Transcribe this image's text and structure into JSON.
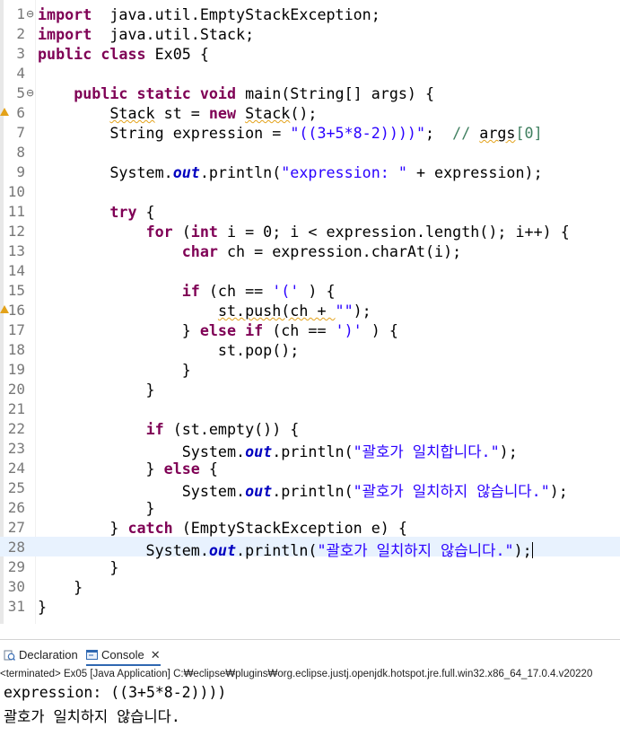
{
  "editor": {
    "lines": [
      {
        "n": "1",
        "fold": "⊖",
        "segs": [
          [
            "kw",
            "import"
          ],
          [
            "",
            "  java.util.EmptyStackException;"
          ]
        ]
      },
      {
        "n": "2",
        "segs": [
          [
            "kw",
            "import"
          ],
          [
            "",
            "  java.util.Stack;"
          ]
        ]
      },
      {
        "n": "3",
        "segs": [
          [
            "kw",
            "public"
          ],
          [
            "",
            " "
          ],
          [
            "kw",
            "class"
          ],
          [
            "",
            " Ex05 {"
          ]
        ]
      },
      {
        "n": "4",
        "segs": []
      },
      {
        "n": "5",
        "fold": "⊖",
        "segs": [
          [
            "",
            "    "
          ],
          [
            "kw",
            "public"
          ],
          [
            "",
            " "
          ],
          [
            "kw",
            "static"
          ],
          [
            "",
            " "
          ],
          [
            "kw",
            "void"
          ],
          [
            "",
            " main(String[] args) {"
          ]
        ]
      },
      {
        "n": "6",
        "warn": true,
        "segs": [
          [
            "",
            "        "
          ],
          [
            "sq",
            "Stack"
          ],
          [
            "",
            " st = "
          ],
          [
            "kw",
            "new"
          ],
          [
            "",
            " "
          ],
          [
            "sq",
            "Stack"
          ],
          [
            "",
            "();"
          ]
        ]
      },
      {
        "n": "7",
        "segs": [
          [
            "",
            "        String expression = "
          ],
          [
            "str",
            "\"((3+5*8-2))))\""
          ],
          [
            "",
            ";  "
          ],
          [
            "cmt",
            "// "
          ],
          [
            "sqc",
            "args"
          ],
          [
            "cmt",
            "[0]"
          ]
        ]
      },
      {
        "n": "8",
        "segs": []
      },
      {
        "n": "9",
        "segs": [
          [
            "",
            "        System."
          ],
          [
            "fld",
            "out"
          ],
          [
            "",
            ".println("
          ],
          [
            "str",
            "\"expression: \""
          ],
          [
            "",
            " + expression);"
          ]
        ]
      },
      {
        "n": "10",
        "segs": []
      },
      {
        "n": "11",
        "segs": [
          [
            "",
            "        "
          ],
          [
            "kw",
            "try"
          ],
          [
            "",
            " {"
          ]
        ]
      },
      {
        "n": "12",
        "segs": [
          [
            "",
            "            "
          ],
          [
            "kw",
            "for"
          ],
          [
            "",
            " ("
          ],
          [
            "kw",
            "int"
          ],
          [
            "",
            " i = 0; i < expression.length(); i++) {"
          ]
        ]
      },
      {
        "n": "13",
        "segs": [
          [
            "",
            "                "
          ],
          [
            "kw",
            "char"
          ],
          [
            "",
            " ch = expression.charAt(i);"
          ]
        ]
      },
      {
        "n": "14",
        "segs": []
      },
      {
        "n": "15",
        "segs": [
          [
            "",
            "                "
          ],
          [
            "kw",
            "if"
          ],
          [
            "",
            " (ch == "
          ],
          [
            "str",
            "'('"
          ],
          [
            "",
            " ) {"
          ]
        ]
      },
      {
        "n": "16",
        "warn": true,
        "segs": [
          [
            "",
            "                    "
          ],
          [
            "sq",
            "st.push(ch + "
          ],
          [
            "str",
            "\"\""
          ],
          [
            "",
            ");"
          ]
        ]
      },
      {
        "n": "17",
        "segs": [
          [
            "",
            "                } "
          ],
          [
            "kw",
            "else"
          ],
          [
            "",
            " "
          ],
          [
            "kw",
            "if"
          ],
          [
            "",
            " (ch == "
          ],
          [
            "str",
            "')'"
          ],
          [
            "",
            " ) {"
          ]
        ]
      },
      {
        "n": "18",
        "segs": [
          [
            "",
            "                    st.pop();"
          ]
        ]
      },
      {
        "n": "19",
        "segs": [
          [
            "",
            "                }"
          ]
        ]
      },
      {
        "n": "20",
        "segs": [
          [
            "",
            "            }"
          ]
        ]
      },
      {
        "n": "21",
        "segs": []
      },
      {
        "n": "22",
        "segs": [
          [
            "",
            "            "
          ],
          [
            "kw",
            "if"
          ],
          [
            "",
            " (st.empty()) {"
          ]
        ]
      },
      {
        "n": "23",
        "segs": [
          [
            "",
            "                System."
          ],
          [
            "fld",
            "out"
          ],
          [
            "",
            ".println("
          ],
          [
            "str",
            "\"괄호가 일치합니다.\""
          ],
          [
            "",
            ");"
          ]
        ]
      },
      {
        "n": "24",
        "segs": [
          [
            "",
            "            } "
          ],
          [
            "kw",
            "else"
          ],
          [
            "",
            " {"
          ]
        ]
      },
      {
        "n": "25",
        "segs": [
          [
            "",
            "                System."
          ],
          [
            "fld",
            "out"
          ],
          [
            "",
            ".println("
          ],
          [
            "str",
            "\"괄호가 일치하지 않습니다.\""
          ],
          [
            "",
            ");"
          ]
        ]
      },
      {
        "n": "26",
        "segs": [
          [
            "",
            "            }"
          ]
        ]
      },
      {
        "n": "27",
        "segs": [
          [
            "",
            "        } "
          ],
          [
            "kw",
            "catch"
          ],
          [
            "",
            " (EmptyStackException e) {"
          ]
        ]
      },
      {
        "n": "28",
        "current": true,
        "caret": true,
        "segs": [
          [
            "",
            "            System."
          ],
          [
            "fld",
            "out"
          ],
          [
            "",
            ".println("
          ],
          [
            "str",
            "\"괄호가 일치하지 않습니다.\""
          ],
          [
            "",
            ");"
          ]
        ]
      },
      {
        "n": "29",
        "segs": [
          [
            "",
            "        }"
          ]
        ]
      },
      {
        "n": "30",
        "segs": [
          [
            "",
            "    }"
          ]
        ]
      },
      {
        "n": "31",
        "segs": [
          [
            "",
            "}"
          ]
        ]
      }
    ]
  },
  "scroll": {
    "left_arrow": "<"
  },
  "tabs": {
    "declaration": "Declaration",
    "console": "Console",
    "close": "✕"
  },
  "console": {
    "status": "<terminated> Ex05 [Java Application] C:₩eclipse₩plugins₩org.eclipse.justj.openjdk.hotspot.jre.full.win32.x86_64_17.0.4.v20220",
    "output": [
      "expression: ((3+5*8-2))))",
      "괄호가 일치하지 않습니다."
    ]
  }
}
